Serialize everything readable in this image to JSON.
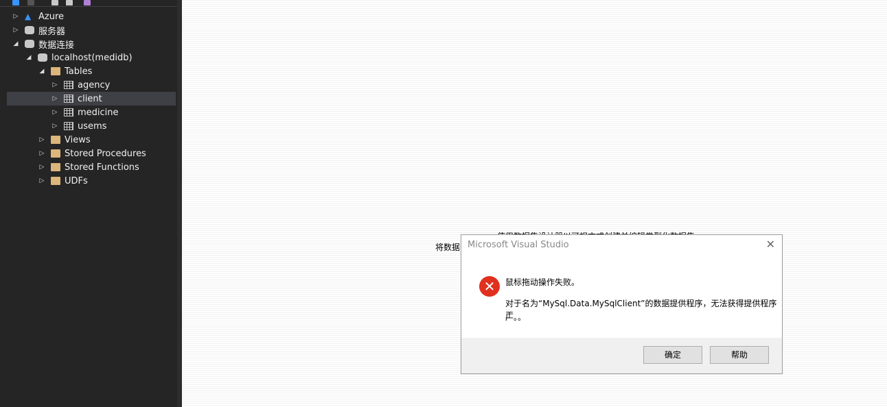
{
  "tree": [
    {
      "label": "Azure",
      "level": 0,
      "expanded": false,
      "icon": "azure-icon"
    },
    {
      "label": "服务器",
      "level": 0,
      "expanded": false,
      "icon": "server-icon"
    },
    {
      "label": "数据连接",
      "level": 0,
      "expanded": true,
      "icon": "data-connections-icon"
    },
    {
      "label": "localhost(medidb)",
      "level": 1,
      "expanded": true,
      "icon": "database-icon"
    },
    {
      "label": "Tables",
      "level": 2,
      "expanded": true,
      "icon": "folder-icon"
    },
    {
      "label": "agency",
      "level": 3,
      "expanded": false,
      "icon": "table-icon"
    },
    {
      "label": "client",
      "level": 3,
      "expanded": false,
      "icon": "table-icon",
      "selected": true
    },
    {
      "label": "medicine",
      "level": 3,
      "expanded": false,
      "icon": "table-icon"
    },
    {
      "label": "usems",
      "level": 3,
      "expanded": false,
      "icon": "table-icon"
    },
    {
      "label": "Views",
      "level": 2,
      "expanded": false,
      "icon": "folder-icon"
    },
    {
      "label": "Stored Procedures",
      "level": 2,
      "expanded": false,
      "icon": "folder-icon"
    },
    {
      "label": "Stored Functions",
      "level": 2,
      "expanded": false,
      "icon": "folder-icon"
    },
    {
      "label": "UDFs",
      "level": 2,
      "expanded": false,
      "icon": "folder-icon"
    }
  ],
  "main": {
    "line1": "使用数据集设计器以可视方式创建并编辑类型化数据集",
    "line2": "将数据"
  },
  "dialog": {
    "title": "Microsoft Visual Studio",
    "heading": "鼠标拖动操作失败。",
    "body_line1": "对于名为“MySql.Data.MySqlClient”的数据提供程序，无法获得提供程序工",
    "body_line2": "厂。。",
    "ok": "确定",
    "help": "帮助",
    "close": "✕"
  }
}
